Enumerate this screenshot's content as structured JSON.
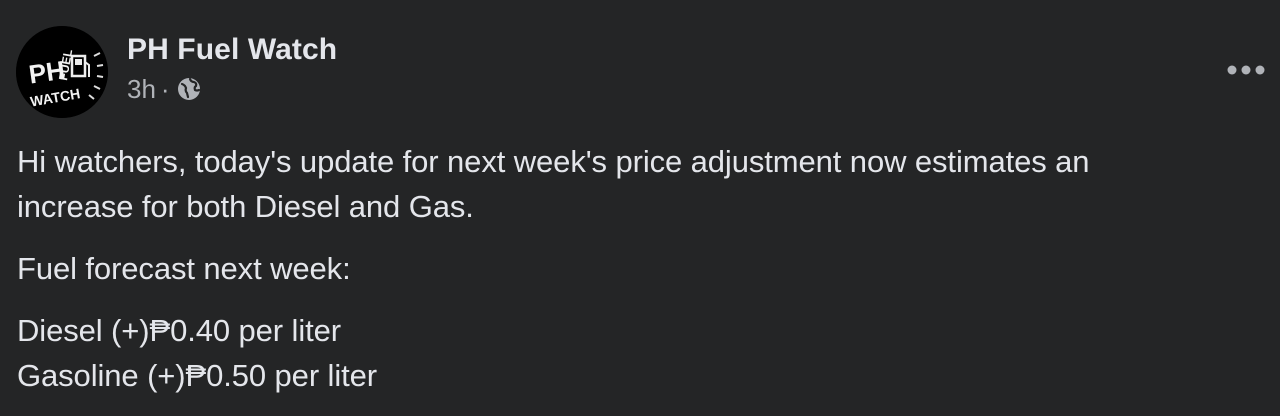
{
  "post": {
    "page_name": "PH Fuel Watch",
    "time": "3h",
    "separator": "·",
    "privacy_icon": "globe-icon",
    "avatar_logo_text": [
      "PH",
      "FUEL",
      "WATCH"
    ],
    "more_icon": "more-horizontal-icon",
    "paragraphs": [
      {
        "lines": [
          "Hi watchers, today's update for next week's price adjustment now estimates an",
          "increase for both Diesel and Gas."
        ]
      },
      {
        "lines": [
          "Fuel forecast next week:"
        ]
      },
      {
        "lines": [
          "Diesel (+)₱0.40 per liter",
          "Gasoline (+)₱0.50 per liter"
        ]
      }
    ]
  },
  "colors": {
    "background": "#242526",
    "primary_text": "#e4e6eb",
    "secondary_text": "#b0b3b8"
  }
}
